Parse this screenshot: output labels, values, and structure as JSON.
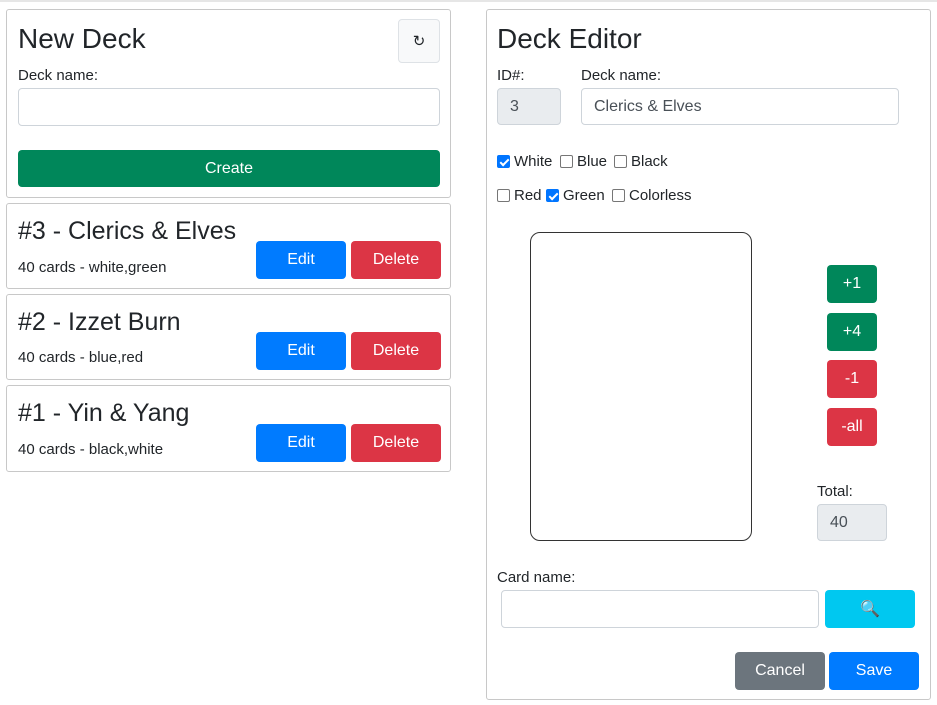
{
  "new_deck": {
    "title": "New Deck",
    "refresh_icon": "↻",
    "deck_name_label": "Deck name:",
    "deck_name_value": "",
    "create_label": "Create"
  },
  "decks": [
    {
      "title": "#3 - Clerics & Elves",
      "subtitle": "40 cards - white,green",
      "edit_label": "Edit",
      "delete_label": "Delete"
    },
    {
      "title": "#2 - Izzet Burn",
      "subtitle": "40 cards - blue,red",
      "edit_label": "Edit",
      "delete_label": "Delete"
    },
    {
      "title": "#1 - Yin & Yang",
      "subtitle": "40 cards - black,white",
      "edit_label": "Edit",
      "delete_label": "Delete"
    }
  ],
  "editor": {
    "title": "Deck Editor",
    "id_label": "ID#:",
    "id_value": "3",
    "deck_name_label": "Deck name:",
    "deck_name_value": "Clerics & Elves",
    "colors": [
      {
        "label": "White",
        "checked": true
      },
      {
        "label": "Blue",
        "checked": false
      },
      {
        "label": "Black",
        "checked": false
      },
      {
        "label": "Red",
        "checked": false
      },
      {
        "label": "Green",
        "checked": true
      },
      {
        "label": "Colorless",
        "checked": false
      }
    ],
    "plus1_label": "+1",
    "plus4_label": "+4",
    "minus1_label": "-1",
    "minus_all_label": "-all",
    "total_label": "Total:",
    "total_value": "40",
    "card_name_label": "Card name:",
    "card_name_value": "",
    "search_icon": "🔍",
    "cancel_label": "Cancel",
    "save_label": "Save"
  },
  "colors": {
    "primary": "#007bff",
    "danger": "#dc3545",
    "success": "#00875a",
    "info": "#00c8f0",
    "secondary": "#6c757d"
  }
}
